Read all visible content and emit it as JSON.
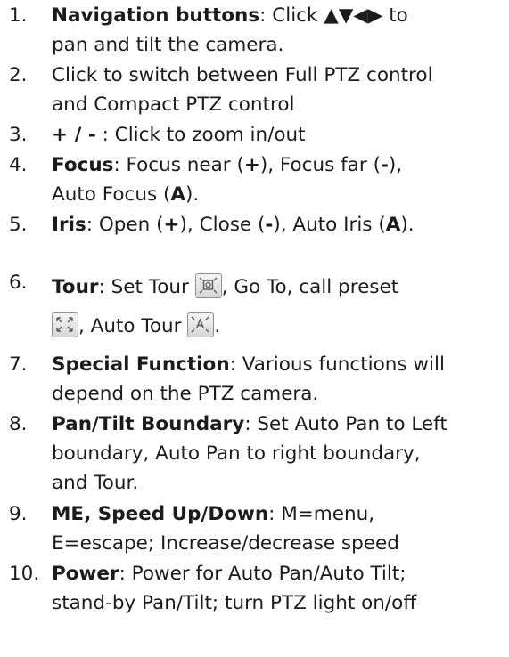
{
  "items": [
    {
      "number": "1.",
      "title": "Navigation buttons",
      "line1": ": Click ",
      "arrows": "▲▼◀▶",
      "line1_end": " to",
      "line2": "pan and tilt the camera."
    },
    {
      "number": "2.",
      "line1": "Click to switch between Full PTZ control",
      "line2": "and Compact PTZ control"
    },
    {
      "number": "3.",
      "title": "+ / -",
      "line1": " : Click to zoom in/out"
    },
    {
      "number": "4.",
      "title": "Focus",
      "line1_a": ": Focus near (",
      "plus": "+",
      "line1_b": "), Focus far (",
      "minus": "-",
      "line1_c": "),",
      "line2_a": "Auto Focus (",
      "auto": "A",
      "line2_b": ")."
    },
    {
      "number": "5.",
      "title": "Iris",
      "line1_a": ": Open (",
      "plus": "+",
      "line1_b": "), Close (",
      "minus": "-",
      "line1_c": "), Auto Iris (",
      "auto": "A",
      "line1_d": ")."
    },
    {
      "number": "6.",
      "title": "Tour",
      "line1_a": ": Set Tour ",
      "line1_b": ", Go To, call preset",
      "line2_a": ", Auto Tour ",
      "line2_b": "."
    },
    {
      "number": "7.",
      "title": "Special Function",
      "line1": ": Various functions will",
      "line2": "depend on the PTZ camera."
    },
    {
      "number": "8.",
      "title": "Pan/Tilt Boundary",
      "line1": ": Set Auto Pan to Left",
      "line2": "boundary, Auto Pan to right boundary,",
      "line3": "and Tour."
    },
    {
      "number": "9.",
      "title": "ME, Speed Up/Down",
      "line1": ": M=menu,",
      "line2": "E=escape; Increase/decrease speed"
    },
    {
      "number": "10.",
      "title": "Power",
      "line1": ": Power for Auto Pan/Auto Tilt;",
      "line2": "stand-by Pan/Tilt; turn PTZ light on/off"
    }
  ],
  "icons": [
    "set-tour-icon",
    "call-preset-icon",
    "auto-tour-icon"
  ],
  "colors": {
    "text": "#1c1c1c",
    "icon_border": "#8f8f8f"
  }
}
